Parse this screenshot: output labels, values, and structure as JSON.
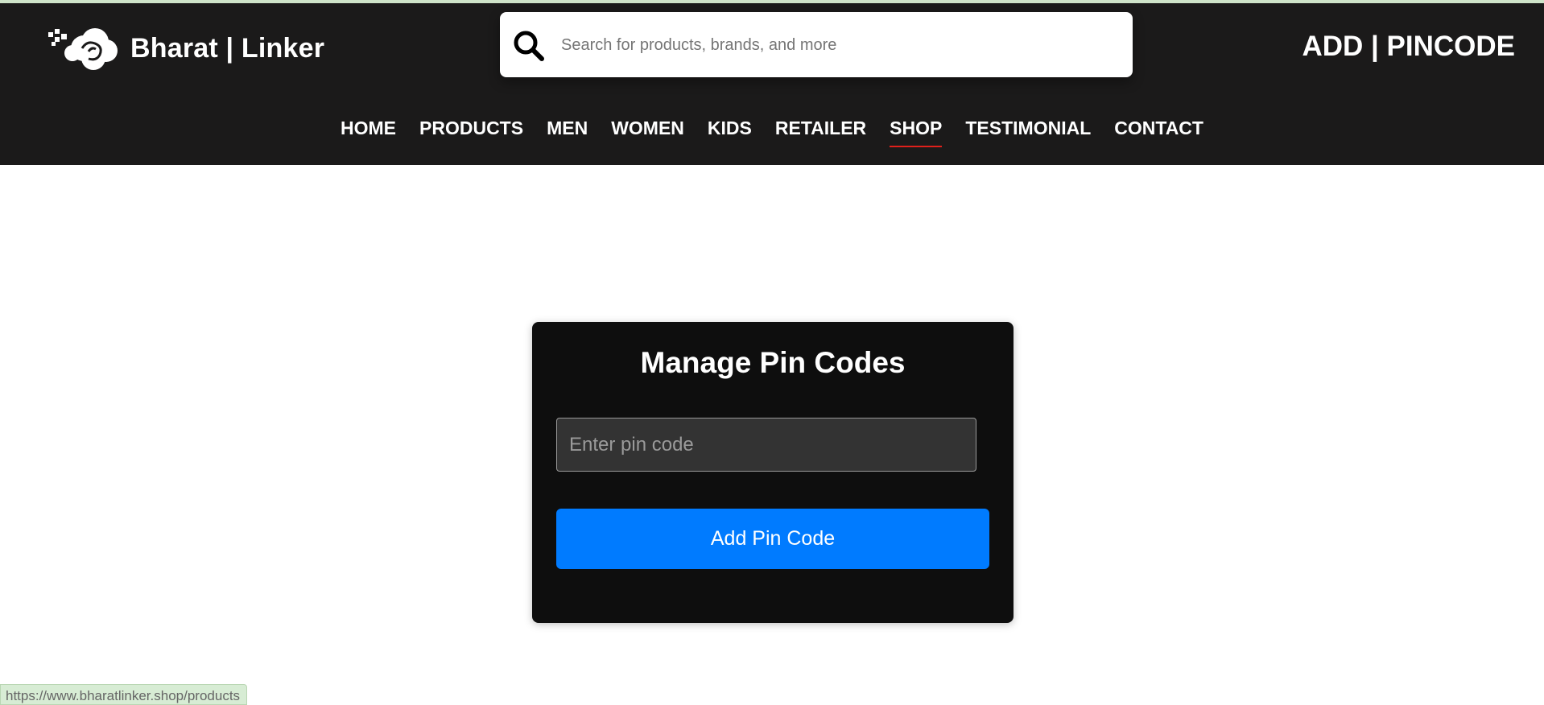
{
  "header": {
    "brand": "Bharat | Linker",
    "search_placeholder": "Search for products, brands, and more",
    "add_pincode_label": "ADD | PINCODE"
  },
  "nav": {
    "items": [
      {
        "label": "HOME"
      },
      {
        "label": "PRODUCTS"
      },
      {
        "label": "MEN"
      },
      {
        "label": "WOMEN"
      },
      {
        "label": "KIDS"
      },
      {
        "label": "RETAILER"
      },
      {
        "label": "SHOP",
        "active": true
      },
      {
        "label": "TESTIMONIAL"
      },
      {
        "label": "CONTACT"
      }
    ]
  },
  "card": {
    "title": "Manage Pin Codes",
    "pin_placeholder": "Enter pin code",
    "pin_value": "",
    "button_label": "Add Pin Code"
  },
  "status_bar": {
    "url": "https://www.bharatlinker.shop/products"
  },
  "colors": {
    "header_bg": "#1b1a1a",
    "card_bg": "#0e0e0e",
    "button_blue": "#007bff",
    "active_underline": "#e0201b"
  },
  "icons": {
    "logo": "cloud-pixels-logo-icon",
    "search": "search-icon"
  }
}
